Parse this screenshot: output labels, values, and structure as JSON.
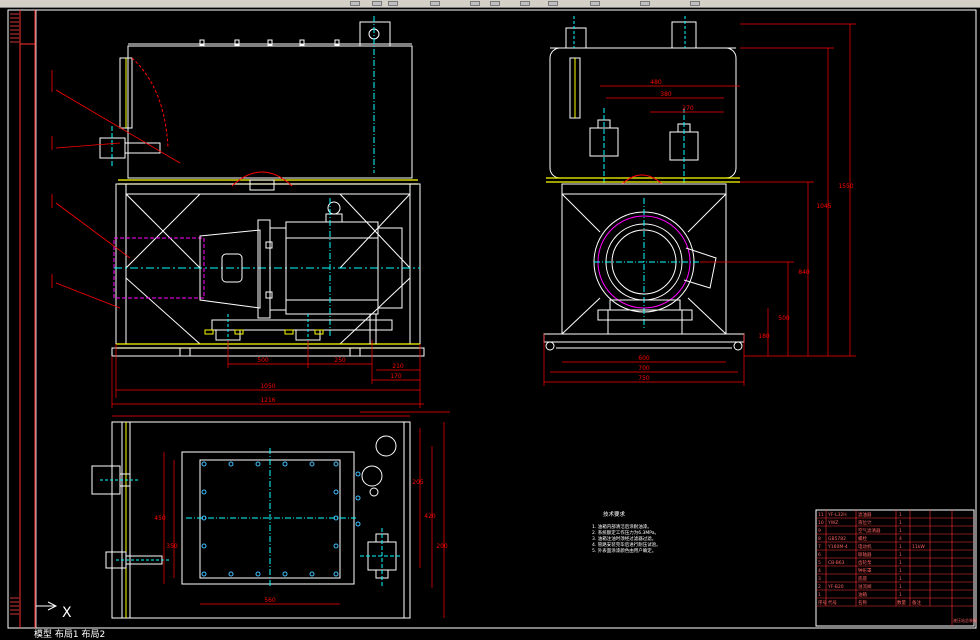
{
  "app": {
    "window_title": "",
    "status_text": "模型  布局1  布局2"
  },
  "ucs": {
    "x_label": "X"
  },
  "drawing": {
    "colors": {
      "background": "#000000",
      "outline": "#ffffff",
      "accent": "#ffff00",
      "dimension": "#ff0000",
      "centerline": "#00ffff",
      "hidden": "#ff00ff",
      "bolt": "#40c0ff"
    },
    "dimensions": {
      "front_width_total": "1216",
      "front_width_base": "1050",
      "front_span_a": "500",
      "front_span_b": "250",
      "front_span_c": "210",
      "front_span_d": "170",
      "side_top_a": "480",
      "side_top_b": "380",
      "side_top_c": "270",
      "side_width_a": "600",
      "side_width_b": "700",
      "side_width_c": "750",
      "side_height_total": "1550",
      "side_height_a": "1045",
      "side_height_b": "840",
      "side_height_c": "500",
      "side_height_d": "180",
      "plan_width": "560",
      "plan_height_a": "450",
      "plan_height_b": "350",
      "plan_right_a": "205",
      "plan_right_b": "420",
      "plan_right_c": "200"
    },
    "notes": {
      "title": "技术要求",
      "lines": [
        "1. 油箱内部清洁后涂耐油漆。",
        "2. 系统额定工作压力为6.3MPa。",
        "3. 油箱注油时须经过滤器过滤。",
        "4. 管路安装完毕后进行耐压试验。",
        "5. 外表面涂漆颜色由用户确定。"
      ]
    },
    "bom": {
      "rows": [
        [
          "11",
          "YF-L32H",
          "滤油器",
          "1",
          ""
        ],
        [
          "10",
          "YWZ",
          "液位计",
          "1",
          ""
        ],
        [
          "9",
          "",
          "空气滤清器",
          "1",
          ""
        ],
        [
          "8",
          "GB5782",
          "螺栓",
          "4",
          ""
        ],
        [
          "7",
          "Y160M-4",
          "电动机",
          "1",
          "11kW"
        ],
        [
          "6",
          "",
          "联轴器",
          "1",
          ""
        ],
        [
          "5",
          "CB-B63",
          "齿轮泵",
          "1",
          ""
        ],
        [
          "4",
          "",
          "钟形罩",
          "1",
          ""
        ],
        [
          "3",
          "",
          "底座",
          "1",
          ""
        ],
        [
          "2",
          "YF-B20",
          "溢流阀",
          "1",
          ""
        ],
        [
          "1",
          "",
          "油箱",
          "1",
          ""
        ]
      ],
      "header": [
        "序号",
        "代号",
        "名称",
        "数量",
        "备注"
      ],
      "title_block": "液压站总装图"
    }
  }
}
